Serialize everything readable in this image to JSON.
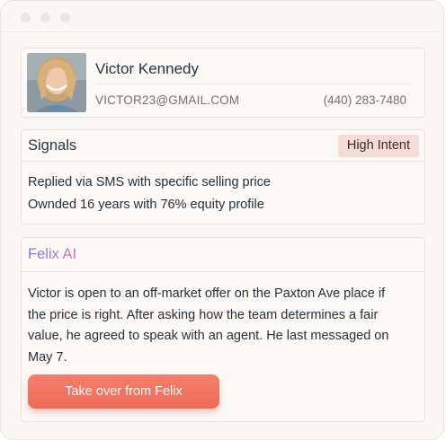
{
  "contact": {
    "name": "Victor Kennedy",
    "email": "VICTOR23@GMAIL.COM",
    "phone": "(440) 283-7480",
    "avatar": "contact-photo"
  },
  "signals": {
    "title": "Signals",
    "badge": "High Intent",
    "items": [
      "Replied via SMS with specific selling price",
      "Ownded 16 years with 76% equity profile"
    ]
  },
  "felix": {
    "title": "Felix AI",
    "summary": "Victor is open to an off-market offer on the Paxton Ave place if the price is right. After asking how the team determines a fair value, he agreed to speak with an agent. He last messaged on May 7.",
    "button_label": "Take over from Felix",
    "button_color": "#f07360"
  },
  "colors": {
    "badge_bg": "#f6dcd6",
    "title_gradient": [
      "#6b7ee8",
      "#d274b0"
    ]
  }
}
